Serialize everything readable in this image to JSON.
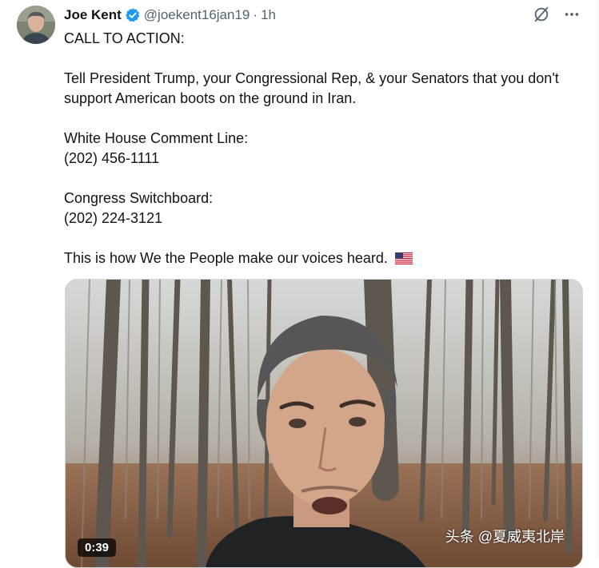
{
  "post": {
    "author_name": "Joe Kent",
    "handle": "@joekent16jan19",
    "separator": "·",
    "time": "1h",
    "verified_icon": "verified-badge-icon",
    "action_icons": [
      "grok-icon",
      "more-icon"
    ],
    "text": {
      "p1": "CALL TO ACTION:",
      "p2": "Tell President Trump, your Congressional Rep, & your Senators that you don't support American boots on the ground in Iran.",
      "p3_label": "White House Comment Line:",
      "p3_value": "(202) 456-1111",
      "p4_label": "Congress Switchboard:",
      "p4_value": "(202) 224-3121",
      "p5": "This is how We the People make our voices heard."
    },
    "video": {
      "duration": "0:39",
      "watermark": "头条 @夏威夷北岸"
    }
  },
  "colors": {
    "accent": "#1d9bf0",
    "secondary_text": "#536471",
    "border": "#cfd9de"
  }
}
